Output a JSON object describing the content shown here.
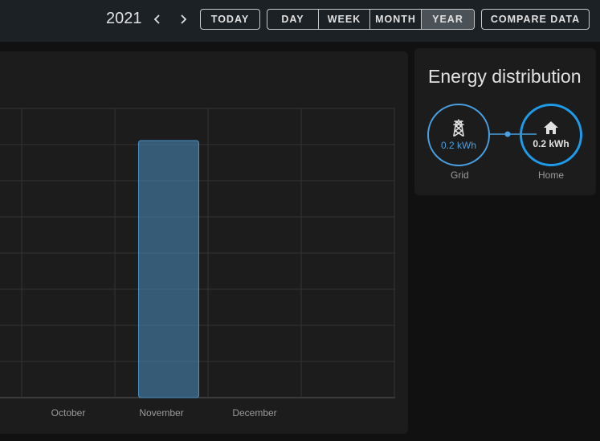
{
  "header": {
    "year": "2021",
    "prev_icon": "chevron-left-icon",
    "next_icon": "chevron-right-icon",
    "today_label": "TODAY",
    "periods": [
      "DAY",
      "WEEK",
      "MONTH",
      "YEAR"
    ],
    "active_period": "YEAR",
    "compare_label": "COMPARE DATA"
  },
  "chart_data": {
    "type": "bar",
    "categories": [
      "October",
      "November",
      "December"
    ],
    "values": [
      0,
      0.2,
      0
    ],
    "ylim": [
      0,
      0.225
    ],
    "grid": true,
    "color": "#4a90c2"
  },
  "energy_distribution": {
    "title": "Energy distribution",
    "grid": {
      "icon": "transmission-tower-icon",
      "value": "0.2 kWh",
      "label": "Grid",
      "color": "#4a9fe0"
    },
    "home": {
      "icon": "home-icon",
      "value": "0.2 kWh",
      "label": "Home",
      "color": "#1e9be9"
    }
  }
}
